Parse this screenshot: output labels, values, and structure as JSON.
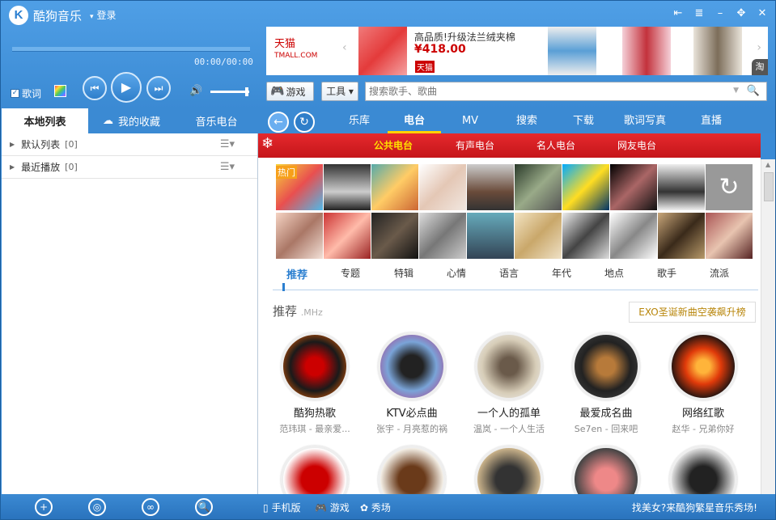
{
  "app": {
    "name": "酷狗音乐",
    "login": "登录",
    "logo": "K"
  },
  "player": {
    "time": "00:00/00:00",
    "lyrics_label": "歌词"
  },
  "ad": {
    "brand": "天猫",
    "brand_sub": "TMALL.COM",
    "title": "高品质!升级法兰绒夹棉",
    "price": "¥418.00",
    "tag": "天猫",
    "corner": "淘"
  },
  "toolbar": {
    "game_label": "游戏",
    "tool_label": "工具",
    "search_placeholder": "搜索歌手、歌曲"
  },
  "left_tabs": [
    "本地列表",
    "我的收藏",
    "音乐电台"
  ],
  "left_lists": [
    {
      "name": "默认列表",
      "count": "[0]"
    },
    {
      "name": "最近播放",
      "count": "[0]"
    }
  ],
  "right_tabs": [
    "乐库",
    "电台",
    "MV",
    "搜索",
    "下载",
    "歌词写真",
    "直播"
  ],
  "banner_tabs": [
    "公共电台",
    "有声电台",
    "名人电台",
    "网友电台"
  ],
  "hot_label": "热门",
  "categories": [
    "推荐",
    "专题",
    "特辑",
    "心情",
    "语言",
    "年代",
    "地点",
    "歌手",
    "流派"
  ],
  "recommend": {
    "title": "推荐",
    "unit": ".MHz",
    "promo": "EXO圣诞新曲空袭飙升榜"
  },
  "stations": [
    {
      "name": "酷狗热歌",
      "sub": "范玮琪 - 最亲爱..."
    },
    {
      "name": "KTV必点曲",
      "sub": "张宇 - 月亮惹的祸"
    },
    {
      "name": "一个人的孤单",
      "sub": "温岚 - 一个人生活"
    },
    {
      "name": "最爱成名曲",
      "sub": "Se7en - 回来吧"
    },
    {
      "name": "网络红歌",
      "sub": "赵华 - 兄弟你好"
    }
  ],
  "bottom": {
    "mobile": "手机版",
    "game": "游戏",
    "show": "秀场",
    "promo": "找美女?来酷狗繁星音乐秀场!"
  },
  "colors": {
    "accent": "#3b8ad3",
    "banner": "#d81e23",
    "highlight": "#ffe000"
  }
}
